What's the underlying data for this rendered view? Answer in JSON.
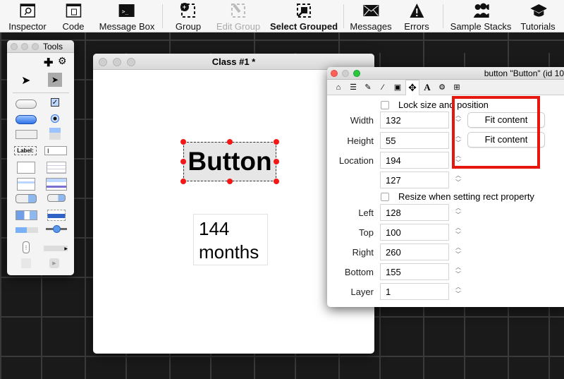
{
  "toolbar": {
    "items": [
      {
        "label": "Inspector",
        "icon": "inspector-icon"
      },
      {
        "label": "Code",
        "icon": "code-icon"
      },
      {
        "label": "Message Box",
        "icon": "message-box-icon"
      },
      {
        "label": "Group",
        "icon": "group-icon"
      },
      {
        "label": "Edit Group",
        "icon": "edit-group-icon"
      },
      {
        "label": "Select Grouped",
        "icon": "select-grouped-icon"
      },
      {
        "label": "Messages",
        "icon": "envelope-icon"
      },
      {
        "label": "Errors",
        "icon": "warning-icon"
      },
      {
        "label": "Sample Stacks",
        "icon": "people-icon"
      },
      {
        "label": "Tutorials",
        "icon": "graduation-cap-icon"
      }
    ]
  },
  "tools": {
    "title": "Tools"
  },
  "stack": {
    "title": "Class #1 *",
    "button_label": "Button",
    "field_text_1": "144",
    "field_text_2": "months"
  },
  "inspector": {
    "title": "button \"Button\" (id 10",
    "lock_label": "Lock size and position",
    "width_label": "Width",
    "width": "132",
    "height_label": "Height",
    "height": "55",
    "location_label": "Location",
    "loc_x": "194",
    "loc_y": "127",
    "fit_label": "Fit content",
    "resize_label": "Resize when setting rect property",
    "left_label": "Left",
    "left": "128",
    "top_label": "Top",
    "top": "100",
    "right_label": "Right",
    "right": "260",
    "bottom_label": "Bottom",
    "bottom": "155",
    "layer_label": "Layer",
    "layer": "1",
    "highlight_color": "#e5170f"
  }
}
